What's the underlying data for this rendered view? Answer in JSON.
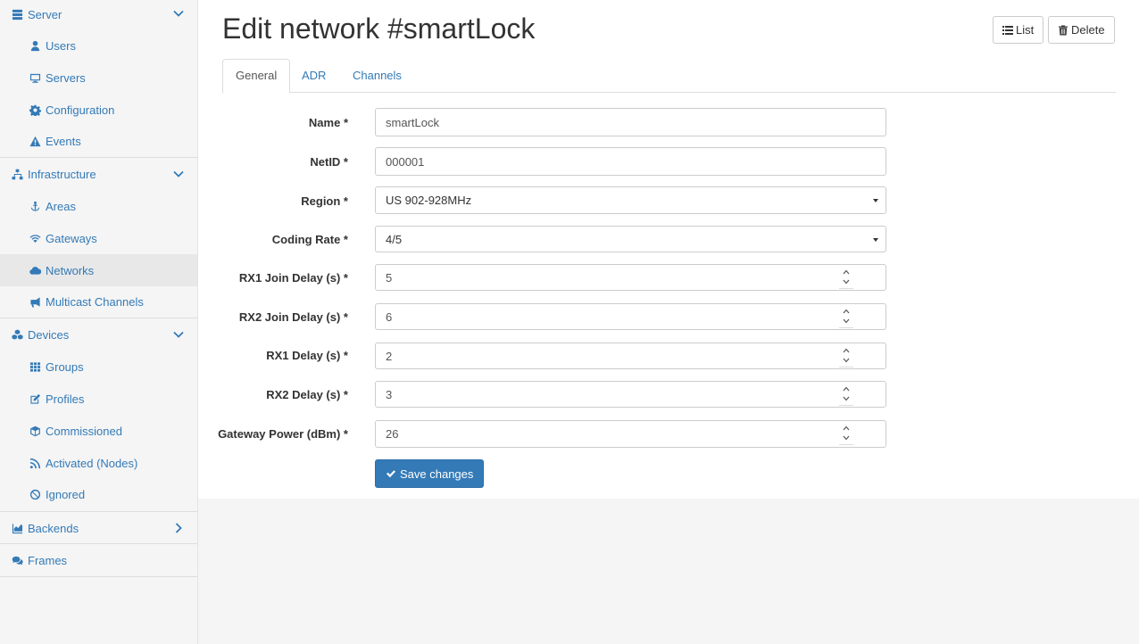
{
  "sidebar": {
    "server": {
      "label": "Server",
      "icon": "server-icon"
    },
    "server_items": [
      {
        "label": "Users",
        "icon": "user-icon"
      },
      {
        "label": "Servers",
        "icon": "desktop-icon"
      },
      {
        "label": "Configuration",
        "icon": "gear-icon"
      },
      {
        "label": "Events",
        "icon": "warning-icon"
      }
    ],
    "infrastructure": {
      "label": "Infrastructure",
      "icon": "sitemap-icon"
    },
    "infrastructure_items": [
      {
        "label": "Areas",
        "icon": "anchor-icon"
      },
      {
        "label": "Gateways",
        "icon": "wifi-icon"
      },
      {
        "label": "Networks",
        "icon": "cloud-icon",
        "active": true
      },
      {
        "label": "Multicast Channels",
        "icon": "bullhorn-icon"
      }
    ],
    "devices": {
      "label": "Devices",
      "icon": "cubes-icon"
    },
    "devices_items": [
      {
        "label": "Groups",
        "icon": "grid-icon"
      },
      {
        "label": "Profiles",
        "icon": "edit-icon"
      },
      {
        "label": "Commissioned",
        "icon": "cube-icon"
      },
      {
        "label": "Activated (Nodes)",
        "icon": "rss-icon"
      },
      {
        "label": "Ignored",
        "icon": "ban-icon"
      }
    ],
    "backends": {
      "label": "Backends",
      "icon": "chart-icon"
    },
    "frames": {
      "label": "Frames",
      "icon": "comments-icon"
    }
  },
  "page": {
    "title": "Edit network #smartLock",
    "list_button": "List",
    "delete_button": "Delete"
  },
  "tabs": [
    "General",
    "ADR",
    "Channels"
  ],
  "form": {
    "name": {
      "label": "Name *",
      "value": "smartLock"
    },
    "netid": {
      "label": "NetID *",
      "value": "000001"
    },
    "region": {
      "label": "Region *",
      "value": "US 902-928MHz"
    },
    "coding_rate": {
      "label": "Coding Rate *",
      "value": "4/5"
    },
    "rx1_join_delay": {
      "label": "RX1 Join Delay (s) *",
      "value": "5"
    },
    "rx2_join_delay": {
      "label": "RX2 Join Delay (s) *",
      "value": "6"
    },
    "rx1_delay": {
      "label": "RX1 Delay (s) *",
      "value": "2"
    },
    "rx2_delay": {
      "label": "RX2 Delay (s) *",
      "value": "3"
    },
    "gateway_power": {
      "label": "Gateway Power (dBm) *",
      "value": "26"
    },
    "save_label": "Save changes"
  },
  "colors": {
    "link": "#337ab7",
    "primary": "#337ab7",
    "sidebar_bg": "#f5f5f5",
    "active_bg": "#e8e8e8"
  }
}
